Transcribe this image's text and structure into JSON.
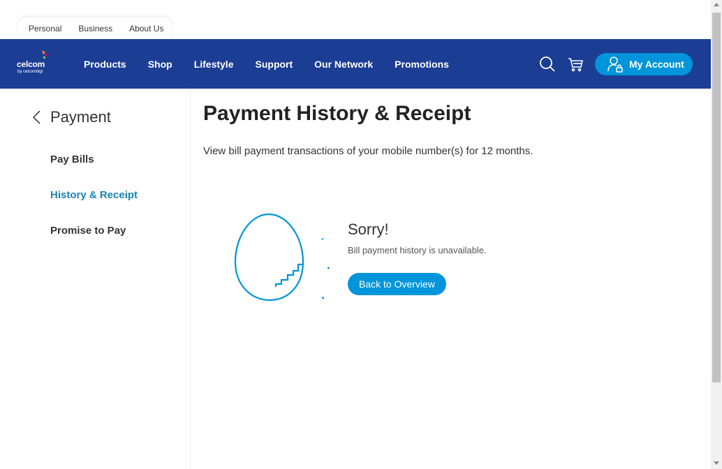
{
  "segments": [
    "Personal",
    "Business",
    "About Us"
  ],
  "logo": {
    "brand": "celcom",
    "sub": "by celcomdigi"
  },
  "nav": {
    "links": [
      "Products",
      "Shop",
      "Lifestyle",
      "Support",
      "Our Network",
      "Promotions"
    ],
    "icons": {
      "search": "search-icon",
      "cart": "cart-icon"
    },
    "account_label": "My Account"
  },
  "sidebar": {
    "back_title": "Payment",
    "items": [
      {
        "label": "Pay Bills",
        "active": false
      },
      {
        "label": "History & Receipt",
        "active": true
      },
      {
        "label": "Promise to Pay",
        "active": false
      }
    ]
  },
  "main": {
    "title": "Payment History & Receipt",
    "description": "View bill payment transactions of your mobile number(s) for 12 months.",
    "empty_state": {
      "title": "Sorry!",
      "message": "Bill payment history is unavailable.",
      "button_label": "Back to Overview",
      "illustration": "cracked-egg-icon"
    }
  },
  "colors": {
    "navbar": "#1b3d94",
    "accent": "#0095da",
    "active_link": "#1a83b5"
  }
}
